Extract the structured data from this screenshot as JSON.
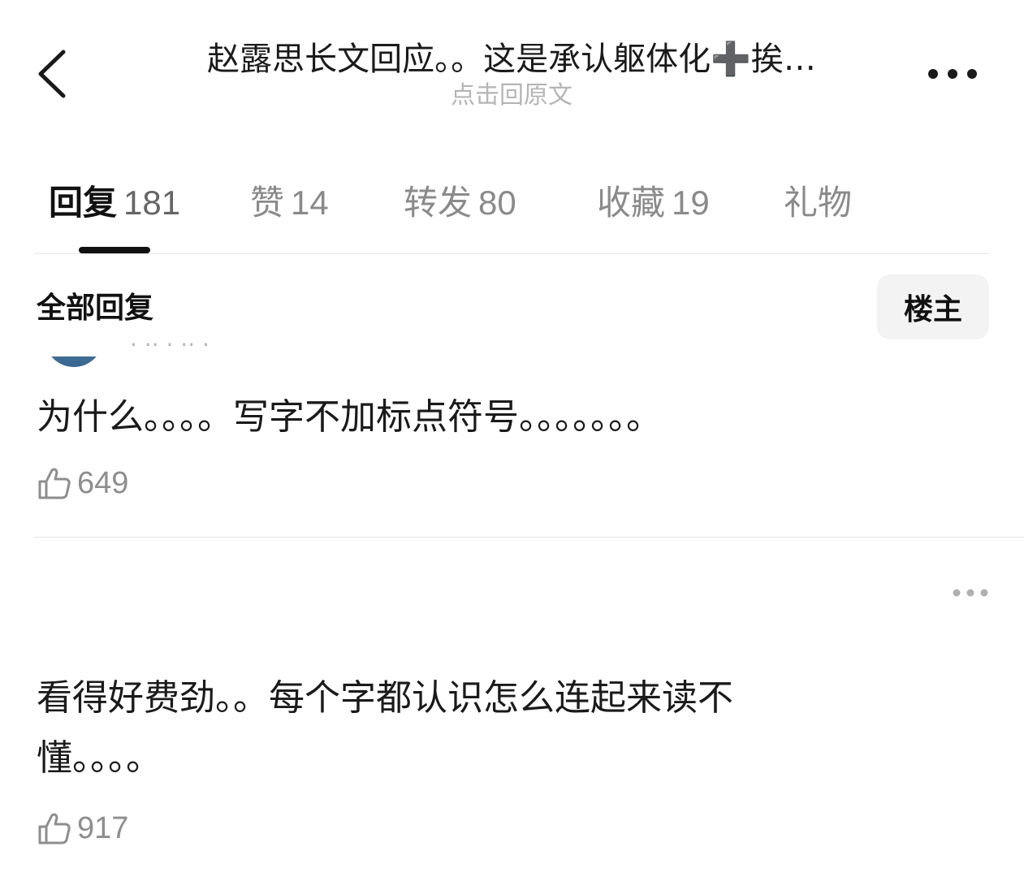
{
  "header": {
    "title": "赵露思长文回应。。这是承认躯体化➕挨…",
    "subtitle": "点击回原文",
    "back_icon": "chevron-left-icon",
    "more_icon": "more-horizontal-icon"
  },
  "tabs": [
    {
      "label": "回复",
      "count": "181",
      "active": true
    },
    {
      "label": "赞",
      "count": "14",
      "active": false
    },
    {
      "label": "转发",
      "count": "80",
      "active": false
    },
    {
      "label": "收藏",
      "count": "19",
      "active": false
    },
    {
      "label": "礼物",
      "count": "",
      "active": false
    }
  ],
  "section": {
    "title": "全部回复",
    "filter_label": "楼主"
  },
  "comments": [
    {
      "text": "为什么。。。。写字不加标点符号。。。。。。。",
      "likes": "649",
      "like_icon": "thumbs-up-icon"
    },
    {
      "text": "看得好费劲。。每个字都认识怎么连起来读不懂。。。。",
      "likes": "917",
      "like_icon": "thumbs-up-icon"
    }
  ],
  "colors": {
    "text_primary": "#1a1a1a",
    "text_secondary": "#8e8e8e",
    "divider": "#e6e6e6",
    "chip_bg": "#f3f3f3"
  }
}
